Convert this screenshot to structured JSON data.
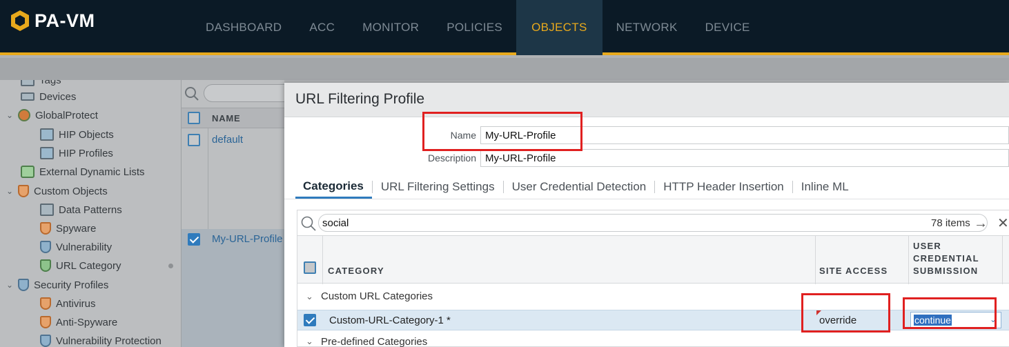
{
  "app": {
    "name": "PA-VM",
    "accent": "#e8a91c"
  },
  "nav": {
    "items": [
      {
        "label": "DASHBOARD"
      },
      {
        "label": "ACC"
      },
      {
        "label": "MONITOR"
      },
      {
        "label": "POLICIES"
      },
      {
        "label": "OBJECTS",
        "active": true
      },
      {
        "label": "NETWORK"
      },
      {
        "label": "DEVICE"
      }
    ]
  },
  "sidebar": {
    "items": [
      {
        "label": "Tags",
        "icon": "tag-icon"
      },
      {
        "label": "Devices",
        "icon": "devices-icon"
      },
      {
        "label": "GlobalProtect",
        "icon": "globalprotect-icon",
        "expanded": true
      },
      {
        "label": "HIP Objects",
        "icon": "hip-objects-icon"
      },
      {
        "label": "HIP Profiles",
        "icon": "hip-profiles-icon"
      },
      {
        "label": "External Dynamic Lists",
        "icon": "external-dynamic-lists-icon"
      },
      {
        "label": "Custom Objects",
        "icon": "custom-objects-icon",
        "expanded": true
      },
      {
        "label": "Data Patterns",
        "icon": "data-patterns-icon"
      },
      {
        "label": "Spyware",
        "icon": "spyware-icon"
      },
      {
        "label": "Vulnerability",
        "icon": "vulnerability-icon"
      },
      {
        "label": "URL Category",
        "icon": "url-category-icon"
      },
      {
        "label": "Security Profiles",
        "icon": "security-profiles-icon",
        "expanded": true
      },
      {
        "label": "Antivirus",
        "icon": "antivirus-icon"
      },
      {
        "label": "Anti-Spyware",
        "icon": "anti-spyware-icon"
      },
      {
        "label": "Vulnerability Protection",
        "icon": "vulnerability-protection-icon"
      }
    ]
  },
  "list": {
    "header": "NAME",
    "rows": [
      {
        "name": "default",
        "checked": false
      },
      {
        "name": "My-URL-Profile",
        "checked": true
      }
    ]
  },
  "modal": {
    "title": "URL Filtering Profile",
    "name_label": "Name",
    "name_value": "My-URL-Profile",
    "description_label": "Description",
    "description_value": "My-URL-Profile",
    "tabs": [
      {
        "label": "Categories",
        "active": true
      },
      {
        "label": "URL Filtering Settings"
      },
      {
        "label": "User Credential Detection"
      },
      {
        "label": "HTTP Header Insertion"
      },
      {
        "label": "Inline ML"
      }
    ],
    "search_value": "social",
    "items_count": "78 items",
    "columns": {
      "category": "CATEGORY",
      "site_access": "SITE ACCESS",
      "user_credential_line1": "USER",
      "user_credential_line2": "CREDENTIAL",
      "user_credential_line3": "SUBMISSION"
    },
    "group_custom": "Custom URL Categories",
    "row": {
      "category": "Custom-URL-Category-1 *",
      "site_access": "override",
      "user_credential_submission": "continue",
      "checked": true
    },
    "group_predefined": "Pre-defined Categories"
  }
}
